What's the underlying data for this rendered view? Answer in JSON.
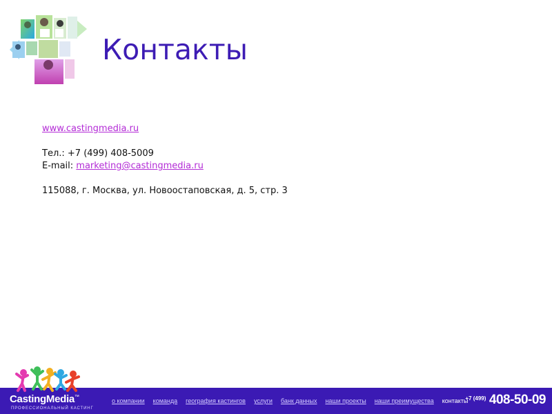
{
  "header": {
    "title": "Контакты"
  },
  "contacts": {
    "website": "www.castingmedia.ru",
    "phone_label": "Тел.: +7 (499) 408-5009",
    "email_label": "E-mail: ",
    "email": "marketing@castingmedia.ru",
    "address": "115088, г. Москва, ул. Новоостаповская, д. 5, стр. 3"
  },
  "footer": {
    "brand": "CastingMedia",
    "trademark": "™",
    "tagline": "ПРОФЕССИОНАЛЬНЫЙ КАСТИНГ",
    "nav": [
      {
        "label": "о компании"
      },
      {
        "label": "команда"
      },
      {
        "label": "география кастингов"
      },
      {
        "label": "услуги"
      },
      {
        "label": "банк данных"
      },
      {
        "label": "наши проекты"
      },
      {
        "label": "наши преимущества"
      },
      {
        "label": "контакты"
      }
    ],
    "phone_code": "+7 (499)",
    "phone_number": "408-50-09"
  },
  "colors": {
    "accent": "#3b1ab4",
    "link": "#b32bd6",
    "title": "#3d1cb4"
  }
}
